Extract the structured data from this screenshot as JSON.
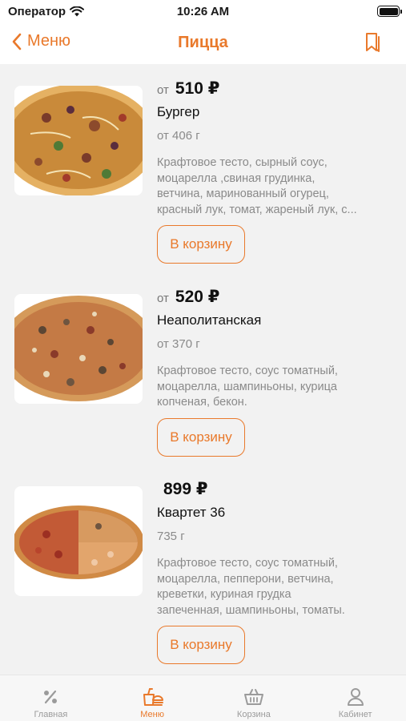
{
  "status_bar": {
    "carrier": "Оператор",
    "time": "10:26 AM"
  },
  "nav": {
    "back_label": "Меню",
    "title": "Пицца"
  },
  "products": [
    {
      "price_prefix": "от",
      "price": "510 ₽",
      "name": "Бургер",
      "weight": "от 406 г",
      "description_lines": [
        "Крафтовое тесто, сырный соус,",
        "моцарелла ,свиная грудинка,",
        "ветчина, маринованный огурец,",
        "красный лук, томат, жареный лук, с..."
      ],
      "button_label": "В корзину"
    },
    {
      "price_prefix": "от",
      "price": "520 ₽",
      "name": "Неаполитанская",
      "weight": "от 370 г",
      "description_lines": [
        "Крафтовое тесто, соус томатный,",
        "моцарелла, шампиньоны, курица",
        "копченая, бекон."
      ],
      "button_label": "В корзину"
    },
    {
      "price_prefix": "",
      "price": "899 ₽",
      "name": "Квартет 36",
      "weight": "735 г",
      "description_lines": [
        "Крафтовое тесто, соус томатный,",
        "моцарелла, пепперони, ветчина,",
        "креветки, куриная грудка",
        "запеченная, шампиньоны, томаты."
      ],
      "button_label": "В корзину"
    }
  ],
  "tabs": [
    {
      "label": "Главная",
      "icon": "percent-icon",
      "active": false
    },
    {
      "label": "Меню",
      "icon": "menu-food-icon",
      "active": true
    },
    {
      "label": "Корзина",
      "icon": "basket-icon",
      "active": false
    },
    {
      "label": "Кабинет",
      "icon": "profile-icon",
      "active": false
    }
  ],
  "colors": {
    "accent": "#e9792b",
    "background": "#f2f2f2",
    "muted_text": "#8a8a8a"
  }
}
